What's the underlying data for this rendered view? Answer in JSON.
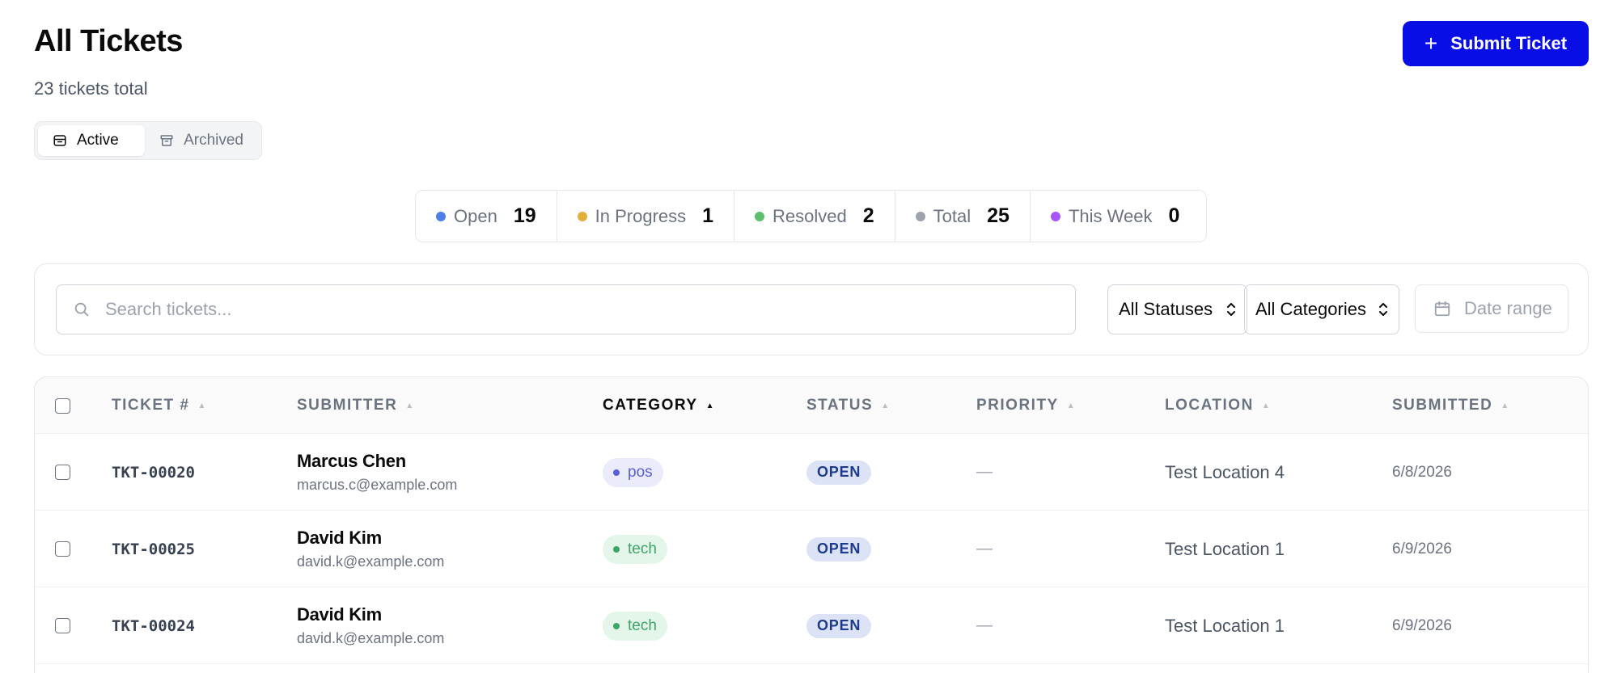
{
  "header": {
    "title": "All Tickets",
    "subtitle": "23 tickets total",
    "submit_label": "Submit Ticket",
    "submit_icon": "plus-icon"
  },
  "view_toggle": {
    "active_label": "Active",
    "archived_label": "Archived",
    "selected": "Active"
  },
  "stats": [
    {
      "label": "Open",
      "value": "19",
      "color": "#4f7ee8"
    },
    {
      "label": "In Progress",
      "value": "1",
      "color": "#e2b03a"
    },
    {
      "label": "Resolved",
      "value": "2",
      "color": "#5cbf6b"
    },
    {
      "label": "Total",
      "value": "25",
      "color": "#9ca3af"
    },
    {
      "label": "This Week",
      "value": "0",
      "color": "#a855f7"
    }
  ],
  "filters": {
    "search_placeholder": "Search tickets...",
    "search_value": "",
    "status_select": "All Statuses",
    "category_select": "All Categories",
    "date_range_label": "Date range"
  },
  "table": {
    "columns": [
      {
        "label": "TICKET #",
        "sorted": false
      },
      {
        "label": "SUBMITTER",
        "sorted": false
      },
      {
        "label": "CATEGORY",
        "sorted": true
      },
      {
        "label": "STATUS",
        "sorted": false
      },
      {
        "label": "PRIORITY",
        "sorted": false
      },
      {
        "label": "LOCATION",
        "sorted": false
      },
      {
        "label": "SUBMITTED",
        "sorted": false
      }
    ],
    "rows": [
      {
        "id": "TKT-00020",
        "name": "Marcus Chen",
        "email": "marcus.c@example.com",
        "category": "pos",
        "status": "OPEN",
        "priority": "—",
        "location": "Test Location 4",
        "submitted": "6/8/2026"
      },
      {
        "id": "TKT-00025",
        "name": "David Kim",
        "email": "david.k@example.com",
        "category": "tech",
        "status": "OPEN",
        "priority": "—",
        "location": "Test Location 1",
        "submitted": "6/9/2026"
      },
      {
        "id": "TKT-00024",
        "name": "David Kim",
        "email": "david.k@example.com",
        "category": "tech",
        "status": "OPEN",
        "priority": "—",
        "location": "Test Location 1",
        "submitted": "6/9/2026"
      }
    ]
  },
  "colors": {
    "accent": "#0a0ee6",
    "pos_bg": "#eaebfb",
    "pos_text": "#5b5fd6",
    "tech_bg": "#e4f5ea",
    "tech_text": "#3fa467",
    "status_open_bg": "#dce3f7",
    "status_open_text": "#1e3a8a"
  }
}
